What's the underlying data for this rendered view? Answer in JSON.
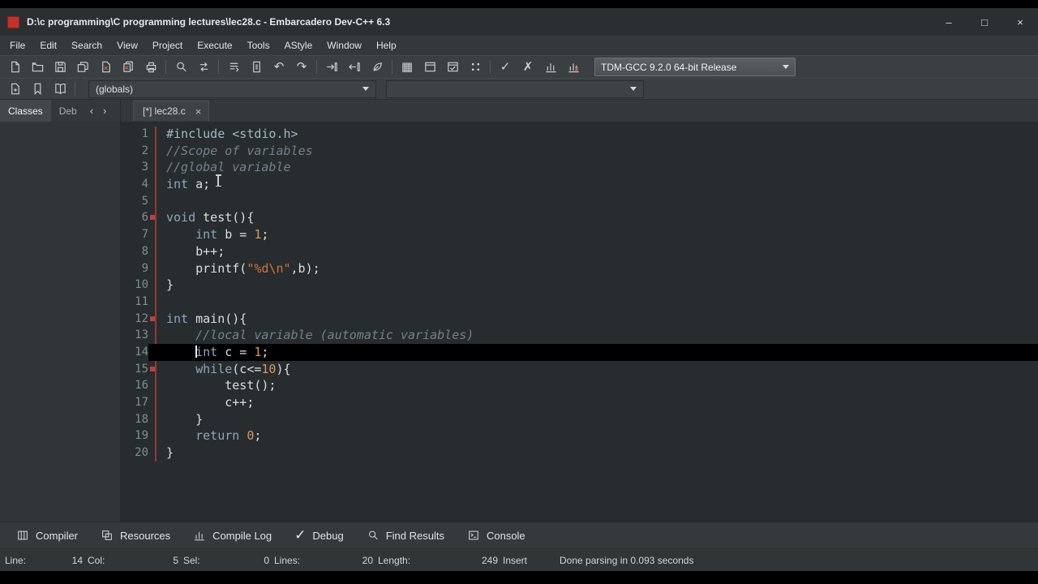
{
  "window": {
    "title": "D:\\c programming\\C programming lectures\\lec28.c - Embarcadero Dev-C++ 6.3",
    "controls": [
      {
        "name": "minimize",
        "glyph": "–"
      },
      {
        "name": "maximize",
        "glyph": "□"
      },
      {
        "name": "close",
        "glyph": "×"
      }
    ]
  },
  "menu": {
    "items": [
      "File",
      "Edit",
      "Search",
      "View",
      "Project",
      "Execute",
      "Tools",
      "AStyle",
      "Window",
      "Help"
    ]
  },
  "toolbar_main": {
    "icons": [
      {
        "name": "new-file"
      },
      {
        "name": "open-file"
      },
      {
        "name": "save"
      },
      {
        "name": "save-all"
      },
      {
        "name": "close-file"
      },
      {
        "name": "close-all"
      },
      {
        "name": "print"
      },
      {
        "sep": true
      },
      {
        "name": "find"
      },
      {
        "name": "replace"
      },
      {
        "sep": true
      },
      {
        "name": "goto-line"
      },
      {
        "name": "swap-header-source"
      },
      {
        "name": "undo",
        "glyph": "↶"
      },
      {
        "name": "redo",
        "glyph": "↷"
      },
      {
        "sep": true
      },
      {
        "name": "step-into"
      },
      {
        "name": "step-out"
      },
      {
        "name": "syntax-check"
      },
      {
        "sep": true
      },
      {
        "name": "compile",
        "glyph": "▦"
      },
      {
        "name": "run"
      },
      {
        "name": "compile-run"
      },
      {
        "name": "rebuild"
      },
      {
        "sep": true
      },
      {
        "name": "check",
        "glyph": "✓"
      },
      {
        "name": "abort",
        "glyph": "✗"
      },
      {
        "name": "profile"
      },
      {
        "name": "profile-delete"
      }
    ],
    "compiler_select": {
      "value": "TDM-GCC 9.2.0 64-bit Release"
    }
  },
  "toolbar_nav": {
    "icons": [
      {
        "name": "insert"
      },
      {
        "name": "bookmark"
      },
      {
        "name": "book"
      }
    ],
    "globals_select": {
      "value": "(globals)"
    },
    "members_select": {
      "value": ""
    }
  },
  "left_tabs": {
    "scroll_left": "‹",
    "scroll_right": "›",
    "tabs": [
      {
        "label": "Classes",
        "active": true
      },
      {
        "label": "Deb",
        "active": false
      }
    ]
  },
  "editor_tabs": [
    {
      "label": "[*] lec28.c",
      "close_glyph": "×",
      "active": true
    }
  ],
  "code": {
    "language": "c",
    "current_line": 14,
    "lines": [
      {
        "n": "1",
        "t": [
          [
            "i",
            "#include <stdio.h>"
          ]
        ]
      },
      {
        "n": "2",
        "t": [
          [
            "c",
            "//Scope of variables"
          ]
        ]
      },
      {
        "n": "3",
        "t": [
          [
            "c",
            "//global variable"
          ]
        ]
      },
      {
        "n": "4",
        "t": [
          [
            "k",
            "int"
          ],
          [
            "p",
            " a;"
          ]
        ]
      },
      {
        "n": "5",
        "t": []
      },
      {
        "n": "6",
        "mark": true,
        "t": [
          [
            "k",
            "void"
          ],
          [
            "p",
            " test(){"
          ]
        ]
      },
      {
        "n": "7",
        "t": [
          [
            "p",
            "    "
          ],
          [
            "k",
            "int"
          ],
          [
            "p",
            " b = "
          ],
          [
            "n",
            "1"
          ],
          [
            "p",
            ";"
          ]
        ]
      },
      {
        "n": "8",
        "t": [
          [
            "p",
            "    b++;"
          ]
        ]
      },
      {
        "n": "9",
        "t": [
          [
            "p",
            "    printf("
          ],
          [
            "s",
            "\"%d\\n\""
          ],
          [
            "p",
            ",b);"
          ]
        ]
      },
      {
        "n": "10",
        "t": [
          [
            "p",
            "}"
          ]
        ]
      },
      {
        "n": "11",
        "t": []
      },
      {
        "n": "12",
        "mark": true,
        "t": [
          [
            "k",
            "int"
          ],
          [
            "p",
            " main(){"
          ]
        ]
      },
      {
        "n": "13",
        "t": [
          [
            "p",
            "    "
          ],
          [
            "c",
            "//local variable (automatic variables)"
          ]
        ]
      },
      {
        "n": "14",
        "hl": true,
        "caret_col": 5,
        "t": [
          [
            "p",
            "    "
          ],
          [
            "k",
            "int"
          ],
          [
            "p",
            " c = "
          ],
          [
            "n",
            "1"
          ],
          [
            "p",
            ";"
          ]
        ]
      },
      {
        "n": "15",
        "mark": true,
        "t": [
          [
            "p",
            "    "
          ],
          [
            "k",
            "while"
          ],
          [
            "p",
            "(c<="
          ],
          [
            "n",
            "10"
          ],
          [
            "p",
            "){"
          ]
        ]
      },
      {
        "n": "16",
        "t": [
          [
            "p",
            "        test();"
          ]
        ]
      },
      {
        "n": "17",
        "t": [
          [
            "p",
            "        c++;"
          ]
        ]
      },
      {
        "n": "18",
        "t": [
          [
            "p",
            "    }"
          ]
        ]
      },
      {
        "n": "19",
        "t": [
          [
            "p",
            "    "
          ],
          [
            "k",
            "return"
          ],
          [
            "p",
            " "
          ],
          [
            "n",
            "0"
          ],
          [
            "p",
            ";"
          ]
        ]
      },
      {
        "n": "20",
        "t": [
          [
            "p",
            "}"
          ]
        ]
      }
    ]
  },
  "bottom_tabs": [
    {
      "label": "Compiler",
      "icon": "panel-grid"
    },
    {
      "label": "Resources",
      "icon": "squares"
    },
    {
      "label": "Compile Log",
      "icon": "chart"
    },
    {
      "label": "Debug",
      "glyph": "✓"
    },
    {
      "label": "Find Results",
      "icon": "find"
    },
    {
      "label": "Console",
      "icon": "console"
    }
  ],
  "status_bar": {
    "panels": [
      {
        "label": "Line:",
        "value": "14"
      },
      {
        "label": "Col:",
        "value": "5"
      },
      {
        "label": "Sel:",
        "value": "0"
      },
      {
        "label": "Lines:",
        "value": "20"
      },
      {
        "label": "Length:",
        "value": "249"
      },
      {
        "label": "",
        "value": "Insert"
      },
      {
        "label": "",
        "value": "Done parsing in 0.093 seconds"
      }
    ]
  },
  "colors": {
    "accent_red": "#c23229",
    "editor_bg": "#272c2e",
    "highlight_line": "#000000",
    "keyword": "#8ca6bd",
    "comment": "#73838a",
    "number": "#d89a54",
    "string": "#cf7440"
  }
}
